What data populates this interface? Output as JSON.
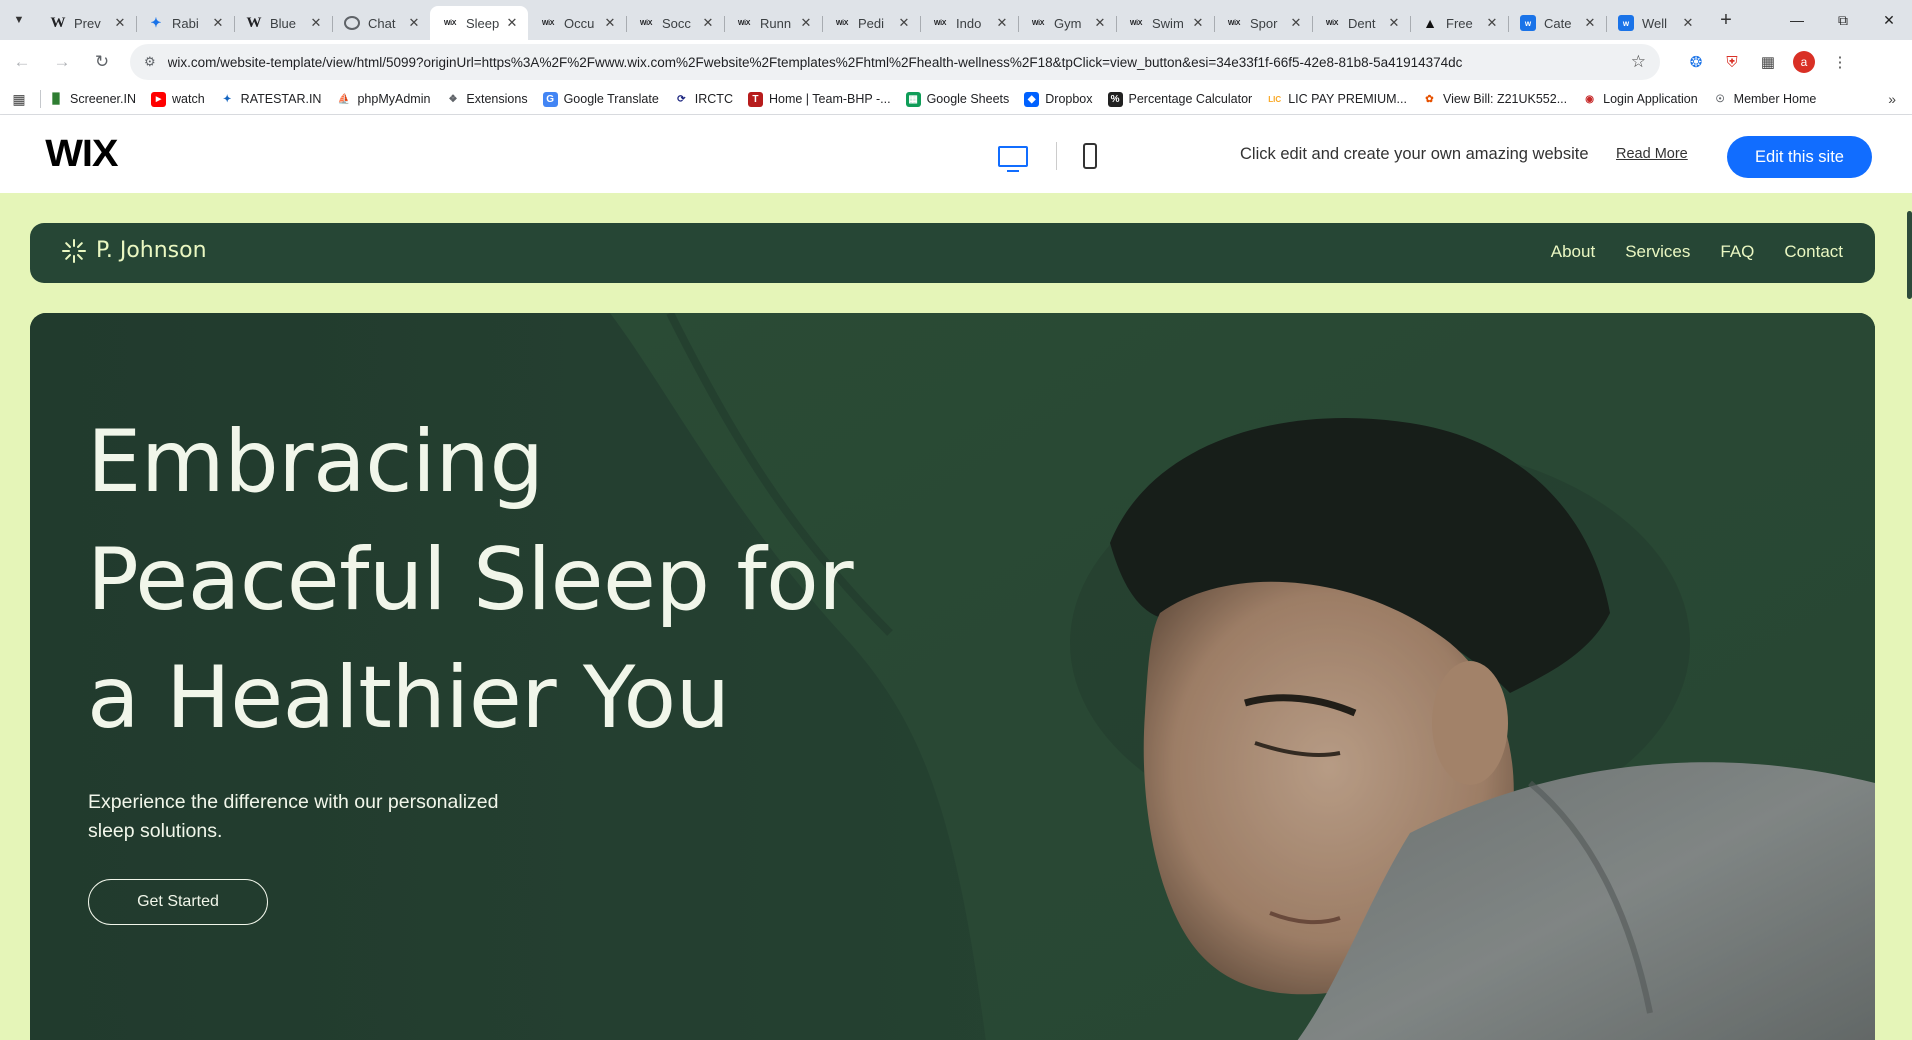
{
  "browser": {
    "tabs": [
      {
        "title": "Prev",
        "icon": "wikipedia-icon",
        "active": false
      },
      {
        "title": "Rabi",
        "icon": "bookmark-app-icon",
        "active": false
      },
      {
        "title": "Blue",
        "icon": "wikipedia-icon",
        "active": false
      },
      {
        "title": "Chat",
        "icon": "chatgpt-icon",
        "active": false
      },
      {
        "title": "Sleep",
        "icon": "wix-icon",
        "active": true
      },
      {
        "title": "Occu",
        "icon": "wix-icon",
        "active": false
      },
      {
        "title": "Socc",
        "icon": "wix-icon",
        "active": false
      },
      {
        "title": "Runn",
        "icon": "wix-icon",
        "active": false
      },
      {
        "title": "Pedi",
        "icon": "wix-icon",
        "active": false
      },
      {
        "title": "Indo",
        "icon": "wix-icon",
        "active": false
      },
      {
        "title": "Gym",
        "icon": "wix-icon",
        "active": false
      },
      {
        "title": "Swim",
        "icon": "wix-icon",
        "active": false
      },
      {
        "title": "Spor",
        "icon": "wix-icon",
        "active": false
      },
      {
        "title": "Dent",
        "icon": "wix-icon",
        "active": false
      },
      {
        "title": "Free",
        "icon": "framer-icon",
        "active": false
      },
      {
        "title": "Cate",
        "icon": "weebly-icon",
        "active": false
      },
      {
        "title": "Well",
        "icon": "weebly-icon",
        "active": false
      }
    ],
    "url": "wix.com/website-template/view/html/5099?originUrl=https%3A%2F%2Fwww.wix.com%2Fwebsite%2Ftemplates%2Fhtml%2Fhealth-wellness%2F18&tpClick=view_button&esi=34e33f1f-66f5-42e8-81b8-5a41914374dc",
    "profile_initial": "a",
    "bookmarks": [
      {
        "label": "Screener.IN",
        "icon": "screener-icon",
        "color": "#2e7d32"
      },
      {
        "label": "watch",
        "icon": "youtube-icon",
        "color": "#ff0000"
      },
      {
        "label": "RATESTAR.IN",
        "icon": "ratestar-icon",
        "color": "#1565c0"
      },
      {
        "label": "phpMyAdmin",
        "icon": "phpmyadmin-icon",
        "color": "#f39c12"
      },
      {
        "label": "Extensions",
        "icon": "puzzle-icon",
        "color": "#5f6368"
      },
      {
        "label": "Google Translate",
        "icon": "translate-icon",
        "color": "#4285f4"
      },
      {
        "label": "IRCTC",
        "icon": "irctc-icon",
        "color": "#1a237e"
      },
      {
        "label": "Home | Team-BHP -...",
        "icon": "teambhp-icon",
        "color": "#b71c1c"
      },
      {
        "label": "Google Sheets",
        "icon": "sheets-icon",
        "color": "#0f9d58"
      },
      {
        "label": "Dropbox",
        "icon": "dropbox-icon",
        "color": "#0061ff"
      },
      {
        "label": "Percentage Calculator",
        "icon": "calculator-icon",
        "color": "#212121"
      },
      {
        "label": "LIC PAY PREMIUM...",
        "icon": "lic-icon",
        "color": "#f9a825"
      },
      {
        "label": "View Bill: Z21UK552...",
        "icon": "bill-icon",
        "color": "#e65100"
      },
      {
        "label": "Login Application",
        "icon": "login-icon",
        "color": "#c62828"
      },
      {
        "label": "Member Home",
        "icon": "globe-icon",
        "color": "#5f6368"
      }
    ]
  },
  "wix_banner": {
    "logo": "WIX",
    "message": "Click edit and create your own amazing website",
    "read_more": "Read More",
    "edit_button": "Edit this site",
    "accent": "#116dff"
  },
  "site": {
    "brand": "P. Johnson",
    "nav": [
      "About",
      "Services",
      "FAQ",
      "Contact"
    ],
    "hero": {
      "title_lines": [
        "Embracing",
        "Peaceful Sleep for",
        "a Healthier You"
      ],
      "subtitle": "Experience the difference with our personalized sleep solutions.",
      "cta": "Get Started"
    },
    "colors": {
      "background": "#e5f5b8",
      "primary": "#264635",
      "text_light": "#f1f6ea"
    }
  }
}
